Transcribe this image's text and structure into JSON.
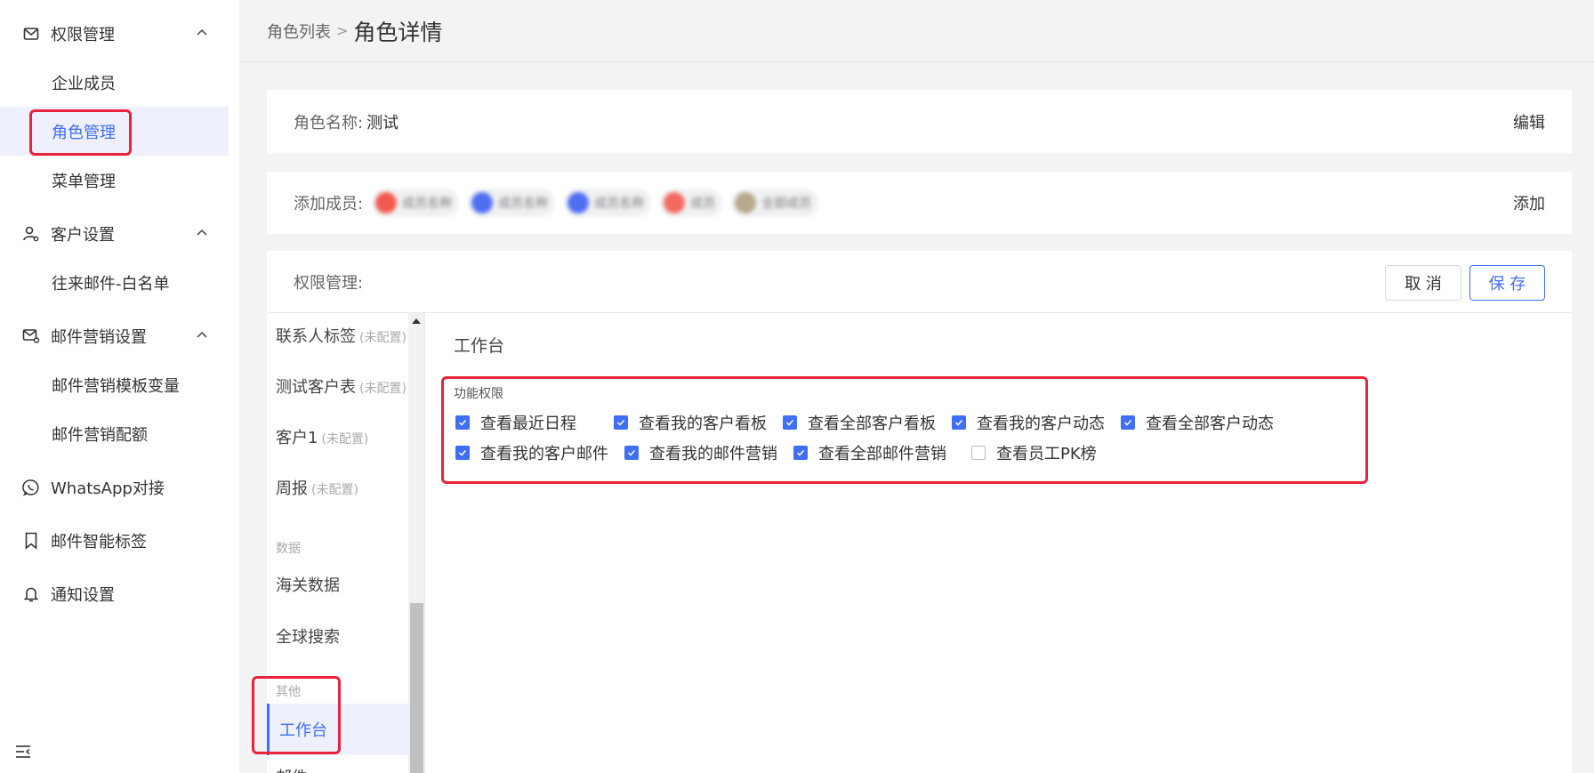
{
  "sidebar": {
    "groups": [
      {
        "label": "权限管理",
        "icon": "mail-icon",
        "items": [
          {
            "label": "企业成员"
          },
          {
            "label": "角色管理",
            "active": true
          },
          {
            "label": "菜单管理"
          }
        ]
      },
      {
        "label": "客户设置",
        "icon": "user-gear-icon",
        "items": [
          {
            "label": "往来邮件-白名单"
          }
        ]
      },
      {
        "label": "邮件营销设置",
        "icon": "mail-gear-icon",
        "items": [
          {
            "label": "邮件营销模板变量"
          },
          {
            "label": "邮件营销配额"
          }
        ]
      },
      {
        "label": "WhatsApp对接",
        "icon": "whatsapp-icon",
        "items": []
      },
      {
        "label": "邮件智能标签",
        "icon": "bookmark-icon",
        "items": []
      },
      {
        "label": "通知设置",
        "icon": "bell-icon",
        "items": []
      }
    ]
  },
  "breadcrumb": {
    "parent": "角色列表",
    "separator": ">",
    "current": "角色详情"
  },
  "role_card": {
    "label": "角色名称:",
    "value": "测试",
    "action": "编辑"
  },
  "members_card": {
    "label": "添加成员:",
    "members": [
      {
        "name": "成员名称",
        "color": "#f25a4f"
      },
      {
        "name": "成员名称",
        "color": "#4f6ff2"
      },
      {
        "name": "成员名称",
        "color": "#4f6ff2"
      },
      {
        "name": "成员",
        "color": "#f26a5f"
      },
      {
        "name": "全部成员",
        "color": "#b8a98e"
      }
    ],
    "action": "添加"
  },
  "permission": {
    "label": "权限管理:",
    "cancel": "取 消",
    "save": "保 存",
    "side": {
      "items": [
        {
          "label": "联系人标签",
          "tag": "(未配置)"
        },
        {
          "label": "测试客户表",
          "tag": "(未配置)"
        },
        {
          "label": "客户1",
          "tag": "(未配置)"
        },
        {
          "label": "周报",
          "tag": "(未配置)"
        }
      ],
      "category_data": "数据",
      "data_items": [
        {
          "label": "海关数据"
        },
        {
          "label": "全球搜索"
        }
      ],
      "category_other": "其他",
      "active_item": "工作台",
      "partial_item": "邮件"
    },
    "main": {
      "title": "工作台",
      "func_label": "功能权限",
      "row1": [
        {
          "label": "查看最近日程",
          "checked": true
        },
        {
          "label": "查看我的客户看板",
          "checked": true
        },
        {
          "label": "查看全部客户看板",
          "checked": true
        },
        {
          "label": "查看我的客户动态",
          "checked": true
        },
        {
          "label": "查看全部客户动态",
          "checked": true
        }
      ],
      "row2": [
        {
          "label": "查看我的客户邮件",
          "checked": true
        },
        {
          "label": "查看我的邮件营销",
          "checked": true
        },
        {
          "label": "查看全部邮件营销",
          "checked": true
        },
        {
          "label": "查看员工PK榜",
          "checked": false
        }
      ]
    }
  },
  "colors": {
    "accent": "#3f6ef7",
    "highlight": "#e8233a",
    "active_bg": "#eef1fd"
  }
}
